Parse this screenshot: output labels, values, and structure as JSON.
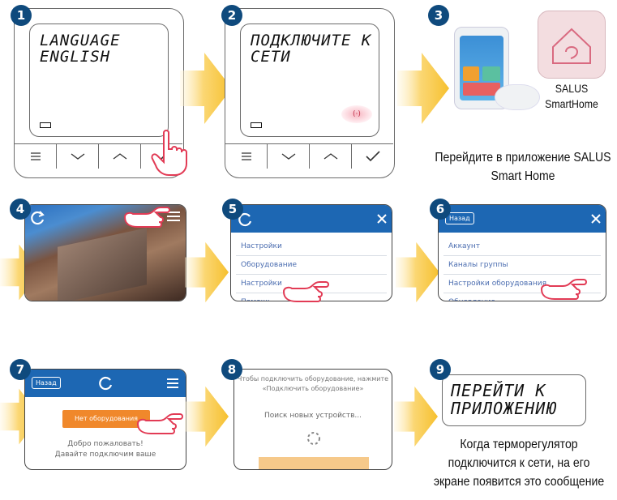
{
  "steps": {
    "s1": {
      "badge": "1",
      "lcd_line1": "LANGUAGE",
      "lcd_line2": "ENGLISH"
    },
    "s2": {
      "badge": "2",
      "lcd_line1": "ПОДКЛЮЧИТЕ К",
      "lcd_line2": "СЕТИ",
      "signal": "(·)"
    },
    "s3": {
      "badge": "3",
      "app_label_1": "SALUS",
      "app_label_2": "SmartHome",
      "caption_1": "Перейдите в приложение SALUS",
      "caption_2": "Smart Home"
    },
    "s4": {
      "badge": "4"
    },
    "s5": {
      "badge": "5",
      "menu": [
        "Настройки",
        "Оборудование",
        "Настройки",
        "Помощь"
      ]
    },
    "s6": {
      "badge": "6",
      "back": "Назад",
      "menu": [
        "Аккаунт",
        "Каналы группы",
        "Настройки оборудования",
        "Обновление"
      ]
    },
    "s7": {
      "badge": "7",
      "back": "Назад",
      "button": "Нет оборудования",
      "text_1": "Добро пожаловать!",
      "text_2": "Давайте подключим ваше"
    },
    "s8": {
      "badge": "8",
      "text_1": "Чтобы подключить оборудование, нажмите",
      "text_2": "«Подключить оборудование»",
      "searching": "Поиск новых устройств..."
    },
    "s9": {
      "badge": "9",
      "lcd_line1": "ПЕРЕЙТИ К",
      "lcd_line2": "ПРИЛОЖЕНИЮ",
      "caption_1": "Когда терморегулятор",
      "caption_2": "подключится к сети, на его",
      "caption_3": "экране появится это сообщение"
    }
  },
  "colors": {
    "badge": "#0f4a7d",
    "arrow": "#f6c02e",
    "appbar": "#1d67b3",
    "finger": "#e23b55",
    "button": "#f0882b"
  },
  "icons": {
    "menu": "menu-icon",
    "down": "chevron-down-icon",
    "up": "chevron-up-icon",
    "ok": "checkmark-icon",
    "hand": "pointing-hand-icon",
    "refresh": "refresh-icon",
    "close": "close-icon",
    "spinner": "spinner-icon"
  }
}
